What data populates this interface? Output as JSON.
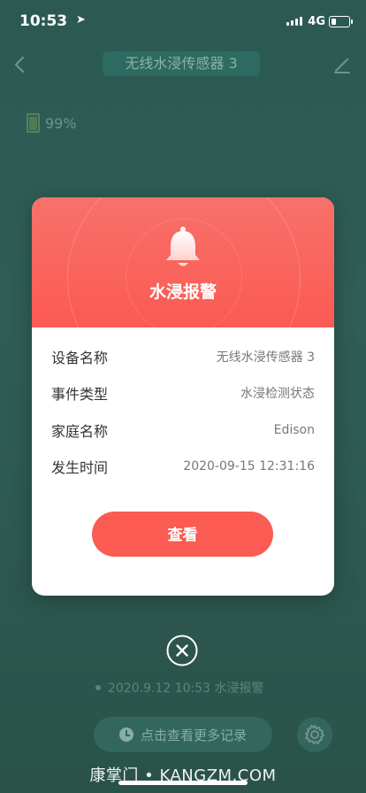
{
  "status_bar": {
    "time": "10:53",
    "network": "4G"
  },
  "header": {
    "title": "无线水浸传感器 3"
  },
  "device": {
    "battery": "99%"
  },
  "alert": {
    "title": "水浸报警",
    "rows": [
      {
        "label": "设备名称",
        "value": "无线水浸传感器 3"
      },
      {
        "label": "事件类型",
        "value": "水浸检测状态"
      },
      {
        "label": "家庭名称",
        "value": "Edison"
      },
      {
        "label": "发生时间",
        "value": "2020-09-15 12:31:16"
      }
    ],
    "view_label": "查看"
  },
  "history": {
    "last_record": "2020.9.12 10:53 水浸报警",
    "more_label": "点击查看更多记录"
  },
  "watermark": "康掌门 • KANGZM.COM",
  "colors": {
    "accent": "#fb5a52",
    "background": "#2f5e56"
  },
  "icons": [
    "location-arrow-icon",
    "signal-icon",
    "battery-icon",
    "back-icon",
    "edit-icon",
    "bell-icon",
    "close-icon",
    "clock-icon",
    "gear-icon"
  ]
}
